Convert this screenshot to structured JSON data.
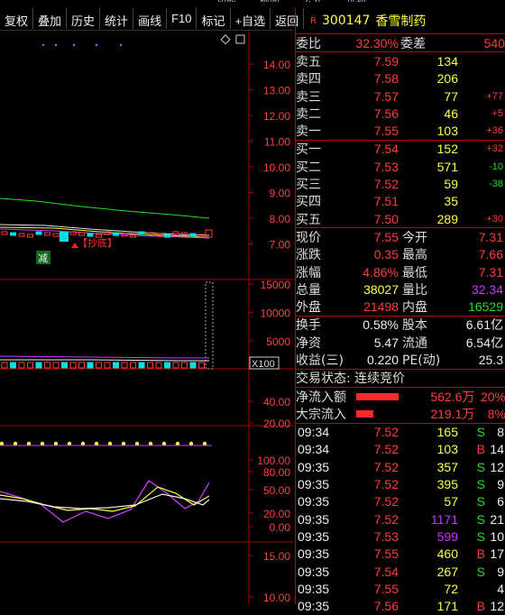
{
  "menu_strip": [
    "功能",
    "版面",
    "公式",
    "选项"
  ],
  "toolbar": [
    "复权",
    "叠加",
    "历史",
    "统计",
    "画线",
    "F10",
    "标记",
    "+自选",
    "返回"
  ],
  "chart": {
    "price_axis": [
      "14.00",
      "13.00",
      "12.00",
      "11.00",
      "10.00",
      "9.00",
      "8.00",
      "7.00"
    ],
    "volume_axis": [
      "15000",
      "10000",
      "5000"
    ],
    "volume_unit": "X100",
    "ind1_axis": [
      "40.00",
      "20.00"
    ],
    "ind2_axis": [
      "100.00",
      "80.00",
      "50.00",
      "20.00",
      "0.00"
    ],
    "ind3_axis": [
      "15.00",
      "10.00"
    ],
    "marker_buy": "【抄底】",
    "marker_reduce": "减",
    "colors": {
      "up": "#ff3c3c",
      "down": "#00e0e0",
      "ma_green": "#22dd22",
      "grid": "#b00000"
    }
  },
  "stock": {
    "flag": "R",
    "code": "300147",
    "name": "香雪制药"
  },
  "wei": {
    "ratio_label": "委比",
    "ratio_value": "32.30%",
    "diff_label": "委差",
    "diff_value": "540"
  },
  "asks": [
    {
      "label": "卖五",
      "price": "7.59",
      "vol": "134",
      "chg": ""
    },
    {
      "label": "卖四",
      "price": "7.58",
      "vol": "206",
      "chg": ""
    },
    {
      "label": "卖三",
      "price": "7.57",
      "vol": "77",
      "chg": "+77"
    },
    {
      "label": "卖二",
      "price": "7.56",
      "vol": "46",
      "chg": "+5"
    },
    {
      "label": "卖一",
      "price": "7.55",
      "vol": "103",
      "chg": "+36"
    }
  ],
  "bids": [
    {
      "label": "买一",
      "price": "7.54",
      "vol": "152",
      "chg": "+32"
    },
    {
      "label": "买二",
      "price": "7.53",
      "vol": "571",
      "chg": "-10"
    },
    {
      "label": "买三",
      "price": "7.52",
      "vol": "59",
      "chg": "-38"
    },
    {
      "label": "买四",
      "price": "7.51",
      "vol": "35",
      "chg": ""
    },
    {
      "label": "买五",
      "price": "7.50",
      "vol": "289",
      "chg": "+30"
    }
  ],
  "quote": [
    {
      "l1": "现价",
      "v1": "7.55",
      "l2": "今开",
      "v2": "7.31"
    },
    {
      "l1": "涨跌",
      "v1": "0.35",
      "l2": "最高",
      "v2": "7.66"
    },
    {
      "l1": "涨幅",
      "v1": "4.86%",
      "l2": "最低",
      "v2": "7.31"
    },
    {
      "l1": "总量",
      "v1": "38027",
      "l2": "量比",
      "v2": "32.34"
    },
    {
      "l1": "外盘",
      "v1": "21498",
      "l2": "内盘",
      "v2": "16529"
    }
  ],
  "fund": [
    {
      "l1": "换手",
      "v1": "0.58%",
      "l2": "股本",
      "v2": "6.61亿"
    },
    {
      "l1": "净资",
      "v1": "5.47",
      "l2": "流通",
      "v2": "6.54亿"
    },
    {
      "l1": "收益(三)",
      "v1": "0.220",
      "l2": "PE(动)",
      "v2": "25.3"
    }
  ],
  "trade_status": "交易状态: 连续竞价",
  "flows": [
    {
      "label": "净流入额",
      "amount": "562.6万",
      "pct": "20%",
      "bar_ratio": 0.8
    },
    {
      "label": "大宗流入",
      "amount": "219.1万",
      "pct": "8%",
      "bar_ratio": 0.32
    }
  ],
  "ticks": [
    {
      "time": "09:34",
      "price": "7.52",
      "vol": "165",
      "side": "S",
      "n": "8"
    },
    {
      "time": "09:34",
      "price": "7.52",
      "vol": "103",
      "side": "B",
      "n": "14"
    },
    {
      "time": "09:35",
      "price": "7.52",
      "vol": "357",
      "side": "S",
      "n": "12"
    },
    {
      "time": "09:35",
      "price": "7.52",
      "vol": "395",
      "side": "S",
      "n": "9"
    },
    {
      "time": "09:35",
      "price": "7.52",
      "vol": "57",
      "side": "S",
      "n": "6"
    },
    {
      "time": "09:35",
      "price": "7.52",
      "vol": "1171",
      "side": "S",
      "n": "21"
    },
    {
      "time": "09:35",
      "price": "7.53",
      "vol": "599",
      "side": "S",
      "n": "10"
    },
    {
      "time": "09:35",
      "price": "7.55",
      "vol": "460",
      "side": "B",
      "n": "17"
    },
    {
      "time": "09:35",
      "price": "7.54",
      "vol": "267",
      "side": "S",
      "n": "9"
    },
    {
      "time": "09:35",
      "price": "7.55",
      "vol": "72",
      "side": "",
      "n": "4"
    },
    {
      "time": "09:35",
      "price": "7.56",
      "vol": "171",
      "side": "B",
      "n": "12"
    }
  ]
}
